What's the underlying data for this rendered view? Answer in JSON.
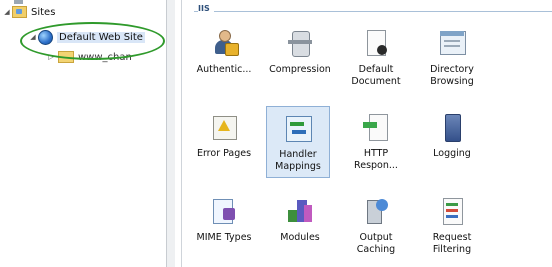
{
  "tree": {
    "sites_label": "Sites",
    "default_site_label": "Default Web Site",
    "child_label": "www_chan"
  },
  "group": {
    "title": "IIS"
  },
  "features": [
    {
      "label": "Authentic...",
      "icon": "authentication-icon"
    },
    {
      "label": "Compression",
      "icon": "compression-icon"
    },
    {
      "label": "Default Document",
      "icon": "default-document-icon"
    },
    {
      "label": "Directory Browsing",
      "icon": "directory-browsing-icon"
    },
    {
      "label": "Error Pages",
      "icon": "error-pages-icon"
    },
    {
      "label": "Handler Mappings",
      "icon": "handler-mappings-icon",
      "selected": true
    },
    {
      "label": "HTTP Respon...",
      "icon": "http-response-icon"
    },
    {
      "label": "Logging",
      "icon": "logging-icon"
    },
    {
      "label": "MIME Types",
      "icon": "mime-types-icon"
    },
    {
      "label": "Modules",
      "icon": "modules-icon"
    },
    {
      "label": "Output Caching",
      "icon": "output-caching-icon"
    },
    {
      "label": "Request Filtering",
      "icon": "request-filtering-icon"
    }
  ],
  "colors": {
    "highlight_ellipse": "#2f9a2b",
    "selection": "#dce9f7"
  }
}
